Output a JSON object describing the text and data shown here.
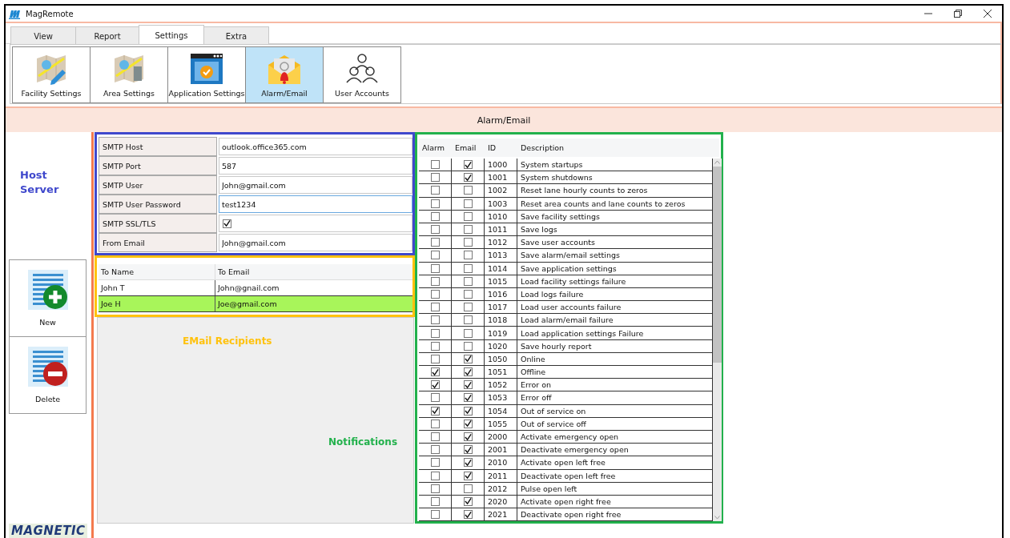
{
  "window": {
    "title": "MagRemote"
  },
  "tabs": [
    {
      "label": "View",
      "selected": false
    },
    {
      "label": "Report",
      "selected": false
    },
    {
      "label": "Settings",
      "selected": true
    },
    {
      "label": "Extra",
      "selected": false
    }
  ],
  "ribbon": [
    {
      "label": "Facility Settings",
      "kind": "facility",
      "selected": false
    },
    {
      "label": "Area Settings",
      "kind": "area",
      "selected": false
    },
    {
      "label": "Application Settings",
      "kind": "application",
      "selected": false
    },
    {
      "label": "Alarm/Email",
      "kind": "alarm",
      "selected": true
    },
    {
      "label": "User Accounts",
      "kind": "users",
      "selected": false
    }
  ],
  "page_title": "Alarm/Email",
  "sidebar": {
    "annotation": "Host Server",
    "buttons": [
      {
        "label": "New",
        "kind": "new"
      },
      {
        "label": "Delete",
        "kind": "delete"
      }
    ],
    "logo": "MAGNETIC"
  },
  "smtp": [
    {
      "label": "SMTP Host",
      "kind": "text",
      "value": "outlook.office365.com",
      "focused": false
    },
    {
      "label": "SMTP Port",
      "kind": "text",
      "value": "587",
      "focused": false
    },
    {
      "label": "SMTP User",
      "kind": "text",
      "value": "John@gmail.com",
      "focused": false
    },
    {
      "label": "SMTP User Password",
      "kind": "text",
      "value": "test1234",
      "focused": true
    },
    {
      "label": "SMTP SSL/TLS",
      "kind": "checkbox",
      "checked": true
    },
    {
      "label": "From Email",
      "kind": "text",
      "value": "John@gmail.com",
      "focused": false
    }
  ],
  "recipients": {
    "columns": [
      "To Name",
      "To Email"
    ],
    "rows": [
      {
        "name": "John T",
        "email": "John@gnail.com",
        "selected": false
      },
      {
        "name": "Joe H",
        "email": "Joe@gmail.com",
        "selected": true
      }
    ]
  },
  "annotations": {
    "recipients": "EMail Recipients",
    "notifications": "Notifications"
  },
  "notifications": {
    "columns": [
      "Alarm",
      "Email",
      "ID",
      "Description"
    ],
    "rows": [
      {
        "alarm": false,
        "email": true,
        "id": "1000",
        "description": "System startups"
      },
      {
        "alarm": false,
        "email": true,
        "id": "1001",
        "description": "System shutdowns"
      },
      {
        "alarm": false,
        "email": false,
        "id": "1002",
        "description": "Reset lane hourly counts to zeros"
      },
      {
        "alarm": false,
        "email": false,
        "id": "1003",
        "description": "Reset area counts and lane counts to zeros"
      },
      {
        "alarm": false,
        "email": false,
        "id": "1010",
        "description": "Save facility settings"
      },
      {
        "alarm": false,
        "email": false,
        "id": "1011",
        "description": "Save logs"
      },
      {
        "alarm": false,
        "email": false,
        "id": "1012",
        "description": "Save user accounts"
      },
      {
        "alarm": false,
        "email": false,
        "id": "1013",
        "description": "Save alarm/email settings"
      },
      {
        "alarm": false,
        "email": false,
        "id": "1014",
        "description": "Save application settings"
      },
      {
        "alarm": false,
        "email": false,
        "id": "1015",
        "description": "Load facility settings failure"
      },
      {
        "alarm": false,
        "email": false,
        "id": "1016",
        "description": "Load logs failure"
      },
      {
        "alarm": false,
        "email": false,
        "id": "1017",
        "description": "Load user accounts failure"
      },
      {
        "alarm": false,
        "email": false,
        "id": "1018",
        "description": "Load alarm/email failure"
      },
      {
        "alarm": false,
        "email": false,
        "id": "1019",
        "description": "Load application settings Failure"
      },
      {
        "alarm": false,
        "email": false,
        "id": "1020",
        "description": "Save hourly report"
      },
      {
        "alarm": false,
        "email": true,
        "id": "1050",
        "description": "Online"
      },
      {
        "alarm": true,
        "email": true,
        "id": "1051",
        "description": "Offline"
      },
      {
        "alarm": true,
        "email": true,
        "id": "1052",
        "description": "Error on"
      },
      {
        "alarm": false,
        "email": true,
        "id": "1053",
        "description": "Error off"
      },
      {
        "alarm": true,
        "email": true,
        "id": "1054",
        "description": "Out of service on"
      },
      {
        "alarm": false,
        "email": true,
        "id": "1055",
        "description": "Out of service off"
      },
      {
        "alarm": false,
        "email": true,
        "id": "2000",
        "description": "Activate emergency open"
      },
      {
        "alarm": false,
        "email": true,
        "id": "2001",
        "description": "Deactivate emergency open"
      },
      {
        "alarm": false,
        "email": true,
        "id": "2010",
        "description": "Activate open left free"
      },
      {
        "alarm": false,
        "email": true,
        "id": "2011",
        "description": "Deactivate open left free"
      },
      {
        "alarm": false,
        "email": false,
        "id": "2012",
        "description": "Pulse open left"
      },
      {
        "alarm": false,
        "email": true,
        "id": "2020",
        "description": "Activate open right free"
      },
      {
        "alarm": false,
        "email": true,
        "id": "2021",
        "description": "Deactivate open right free"
      }
    ]
  }
}
